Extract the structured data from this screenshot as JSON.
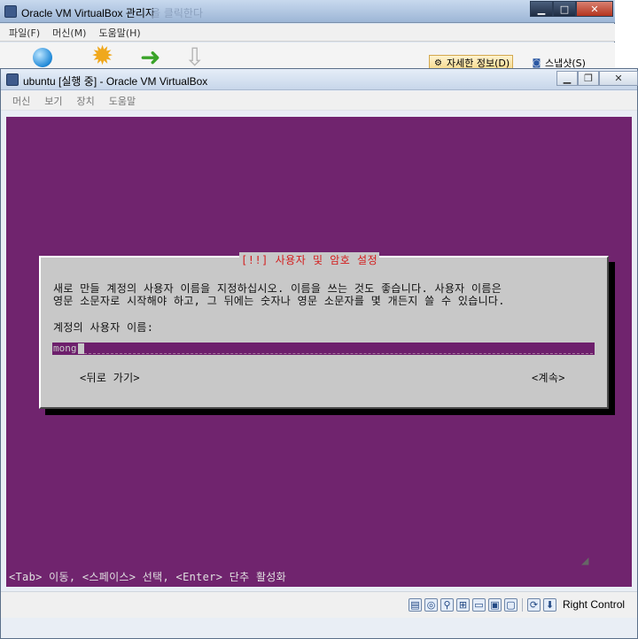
{
  "manager": {
    "title": "Oracle VM VirtualBox 관리자",
    "faded_text": "을 클릭한다",
    "menu": [
      "파일(F)",
      "머신(M)",
      "도움말(H)"
    ],
    "details_label": "자세한 정보(D)",
    "snapshots_label": "스냅샷(S)"
  },
  "vm": {
    "title": "ubuntu [실행 중] - Oracle VM VirtualBox",
    "menu": [
      "머신",
      "보기",
      "장치",
      "도움말"
    ]
  },
  "installer": {
    "dialog_title": "[!!] 사용자 및 암호 설정",
    "description_line1": "새로 만들 계정의 사용자 이름을 지정하십시오. 이름을 쓰는 것도 좋습니다. 사용자 이름은",
    "description_line2": "영문 소문자로 시작해야 하고, 그 뒤에는 숫자나 영문 소문자를 몇 개든지 쓸 수 있습니다.",
    "field_label": "계정의 사용자 이름:",
    "username_value": "mong",
    "back_button": "<뒤로 가기>",
    "continue_button": "<계속>",
    "status_line": "<Tab> 이동, <스페이스> 선택, <Enter> 단추 활성화"
  },
  "statusbar": {
    "host_key": "Right Control"
  },
  "colors": {
    "guest_background": "#70246e",
    "dialog_background": "#c8c8c8",
    "dialog_title": "#d31b1b"
  }
}
